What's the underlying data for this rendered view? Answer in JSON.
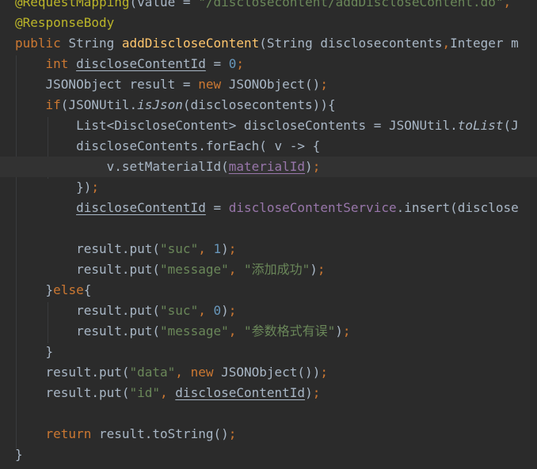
{
  "colors": {
    "background": "#2b2b2b",
    "current_line": "#323232",
    "default_text": "#a9b7c6",
    "keyword": "#cc7832",
    "annotation": "#bbb529",
    "string": "#6a8759",
    "number": "#6897bb",
    "method_declaration": "#ffc66d",
    "field": "#9876aa"
  },
  "code_lines": [
    {
      "tokens": [
        {
          "t": "@RequestMapping",
          "k": "annotation"
        },
        {
          "t": "(value = ",
          "k": "default"
        },
        {
          "t": "\"/disclosecontent/addDiscloseContent.do\"",
          "k": "string"
        },
        {
          "t": ",",
          "k": "keyword"
        }
      ]
    },
    {
      "tokens": [
        {
          "t": "@ResponseBody",
          "k": "annotation"
        }
      ]
    },
    {
      "tokens": [
        {
          "t": "public ",
          "k": "keyword"
        },
        {
          "t": "String ",
          "k": "default"
        },
        {
          "t": "addDiscloseContent",
          "k": "method-decl"
        },
        {
          "t": "(String disclosecontents",
          "k": "default"
        },
        {
          "t": ",",
          "k": "keyword"
        },
        {
          "t": "Integer m",
          "k": "default"
        }
      ]
    },
    {
      "tokens": [
        {
          "t": "    ",
          "k": "default"
        },
        {
          "t": "int ",
          "k": "keyword"
        },
        {
          "t": "discloseContentId",
          "k": "underline"
        },
        {
          "t": " = ",
          "k": "default"
        },
        {
          "t": "0",
          "k": "number"
        },
        {
          "t": ";",
          "k": "keyword"
        }
      ]
    },
    {
      "tokens": [
        {
          "t": "    JSONObject result = ",
          "k": "default"
        },
        {
          "t": "new ",
          "k": "keyword"
        },
        {
          "t": "JSONObject()",
          "k": "default"
        },
        {
          "t": ";",
          "k": "keyword"
        }
      ]
    },
    {
      "tokens": [
        {
          "t": "    ",
          "k": "default"
        },
        {
          "t": "if",
          "k": "keyword"
        },
        {
          "t": "(JSONUtil.",
          "k": "default"
        },
        {
          "t": "isJson",
          "k": "static"
        },
        {
          "t": "(disclosecontents)){",
          "k": "default"
        }
      ]
    },
    {
      "tokens": [
        {
          "t": "        List<DiscloseContent> discloseContents = JSONUtil.",
          "k": "default"
        },
        {
          "t": "toList",
          "k": "static"
        },
        {
          "t": "(J",
          "k": "default"
        }
      ]
    },
    {
      "tokens": [
        {
          "t": "        discloseContents.forEach( v -> {",
          "k": "default"
        }
      ]
    },
    {
      "current": true,
      "tokens": [
        {
          "t": "            v.setMaterialId(",
          "k": "default"
        },
        {
          "t": "materialId",
          "k": "field-underline"
        },
        {
          "t": ")",
          "k": "default"
        },
        {
          "t": ";",
          "k": "keyword"
        }
      ]
    },
    {
      "tokens": [
        {
          "t": "        })",
          "k": "default"
        },
        {
          "t": ";",
          "k": "keyword"
        }
      ]
    },
    {
      "tokens": [
        {
          "t": "        ",
          "k": "default"
        },
        {
          "t": "discloseContentId",
          "k": "underline"
        },
        {
          "t": " = ",
          "k": "default"
        },
        {
          "t": "discloseContentService",
          "k": "field"
        },
        {
          "t": ".insert(disclose",
          "k": "default"
        }
      ]
    },
    {
      "tokens": []
    },
    {
      "tokens": [
        {
          "t": "        result.put(",
          "k": "default"
        },
        {
          "t": "\"suc\"",
          "k": "string"
        },
        {
          "t": ", ",
          "k": "keyword"
        },
        {
          "t": "1",
          "k": "number"
        },
        {
          "t": ")",
          "k": "default"
        },
        {
          "t": ";",
          "k": "keyword"
        }
      ]
    },
    {
      "tokens": [
        {
          "t": "        result.put(",
          "k": "default"
        },
        {
          "t": "\"message\"",
          "k": "string"
        },
        {
          "t": ", ",
          "k": "keyword"
        },
        {
          "t": "\"添加成功\"",
          "k": "string"
        },
        {
          "t": ")",
          "k": "default"
        },
        {
          "t": ";",
          "k": "keyword"
        }
      ]
    },
    {
      "tokens": [
        {
          "t": "    }",
          "k": "default"
        },
        {
          "t": "else",
          "k": "keyword"
        },
        {
          "t": "{",
          "k": "default"
        }
      ]
    },
    {
      "tokens": [
        {
          "t": "        result.put(",
          "k": "default"
        },
        {
          "t": "\"suc\"",
          "k": "string"
        },
        {
          "t": ", ",
          "k": "keyword"
        },
        {
          "t": "0",
          "k": "number"
        },
        {
          "t": ")",
          "k": "default"
        },
        {
          "t": ";",
          "k": "keyword"
        }
      ]
    },
    {
      "tokens": [
        {
          "t": "        result.put(",
          "k": "default"
        },
        {
          "t": "\"message\"",
          "k": "string"
        },
        {
          "t": ", ",
          "k": "keyword"
        },
        {
          "t": "\"参数格式有误\"",
          "k": "string"
        },
        {
          "t": ")",
          "k": "default"
        },
        {
          "t": ";",
          "k": "keyword"
        }
      ]
    },
    {
      "tokens": [
        {
          "t": "    }",
          "k": "default"
        }
      ]
    },
    {
      "tokens": [
        {
          "t": "    result.put(",
          "k": "default"
        },
        {
          "t": "\"data\"",
          "k": "string"
        },
        {
          "t": ", ",
          "k": "keyword"
        },
        {
          "t": "new ",
          "k": "keyword"
        },
        {
          "t": "JSONObject())",
          "k": "default"
        },
        {
          "t": ";",
          "k": "keyword"
        }
      ]
    },
    {
      "tokens": [
        {
          "t": "    result.put(",
          "k": "default"
        },
        {
          "t": "\"id\"",
          "k": "string"
        },
        {
          "t": ", ",
          "k": "keyword"
        },
        {
          "t": "discloseContentId",
          "k": "underline"
        },
        {
          "t": ")",
          "k": "default"
        },
        {
          "t": ";",
          "k": "keyword"
        }
      ]
    },
    {
      "tokens": []
    },
    {
      "tokens": [
        {
          "t": "    ",
          "k": "default"
        },
        {
          "t": "return ",
          "k": "keyword"
        },
        {
          "t": "result.toString()",
          "k": "default"
        },
        {
          "t": ";",
          "k": "keyword"
        }
      ]
    },
    {
      "tokens": [
        {
          "t": "}",
          "k": "default"
        }
      ]
    }
  ]
}
